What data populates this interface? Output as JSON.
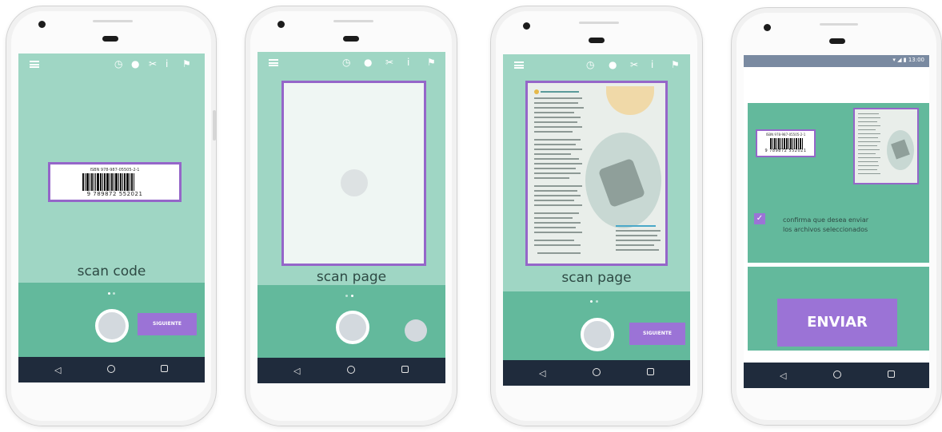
{
  "phone1": {
    "isbn_text": "ISBN 978-987-05505-2-1",
    "barcode_digits": "9 789872 552021",
    "label": "scan code",
    "next_button": "SIGUIENTE"
  },
  "phone2": {
    "label": "scan page"
  },
  "phone3": {
    "label": "scan page",
    "next_button": "SIGUIENTE"
  },
  "phone4": {
    "status_time": "13:00",
    "status_icons": "▾ ◢ ▮",
    "isbn_text": "ISBN 978-987-05505-2-1",
    "barcode_digits": "9 789872 552021",
    "confirm_text_line1": "confirma que desea enviar",
    "confirm_text_line2": "los archivos seleccionados",
    "send_button": "ENVIAR"
  },
  "icons": [
    "menu-icon",
    "timer-icon",
    "person-icon",
    "crop-icon",
    "brightness-icon",
    "flash-icon",
    "back-icon",
    "home-icon",
    "recent-apps-icon",
    "check-icon"
  ],
  "colors": {
    "screen_bg": "#9fd6c4",
    "bottom_bar": "#63b99c",
    "accent_purple": "#9b73d6",
    "nav_bar": "#1f2b3c"
  }
}
